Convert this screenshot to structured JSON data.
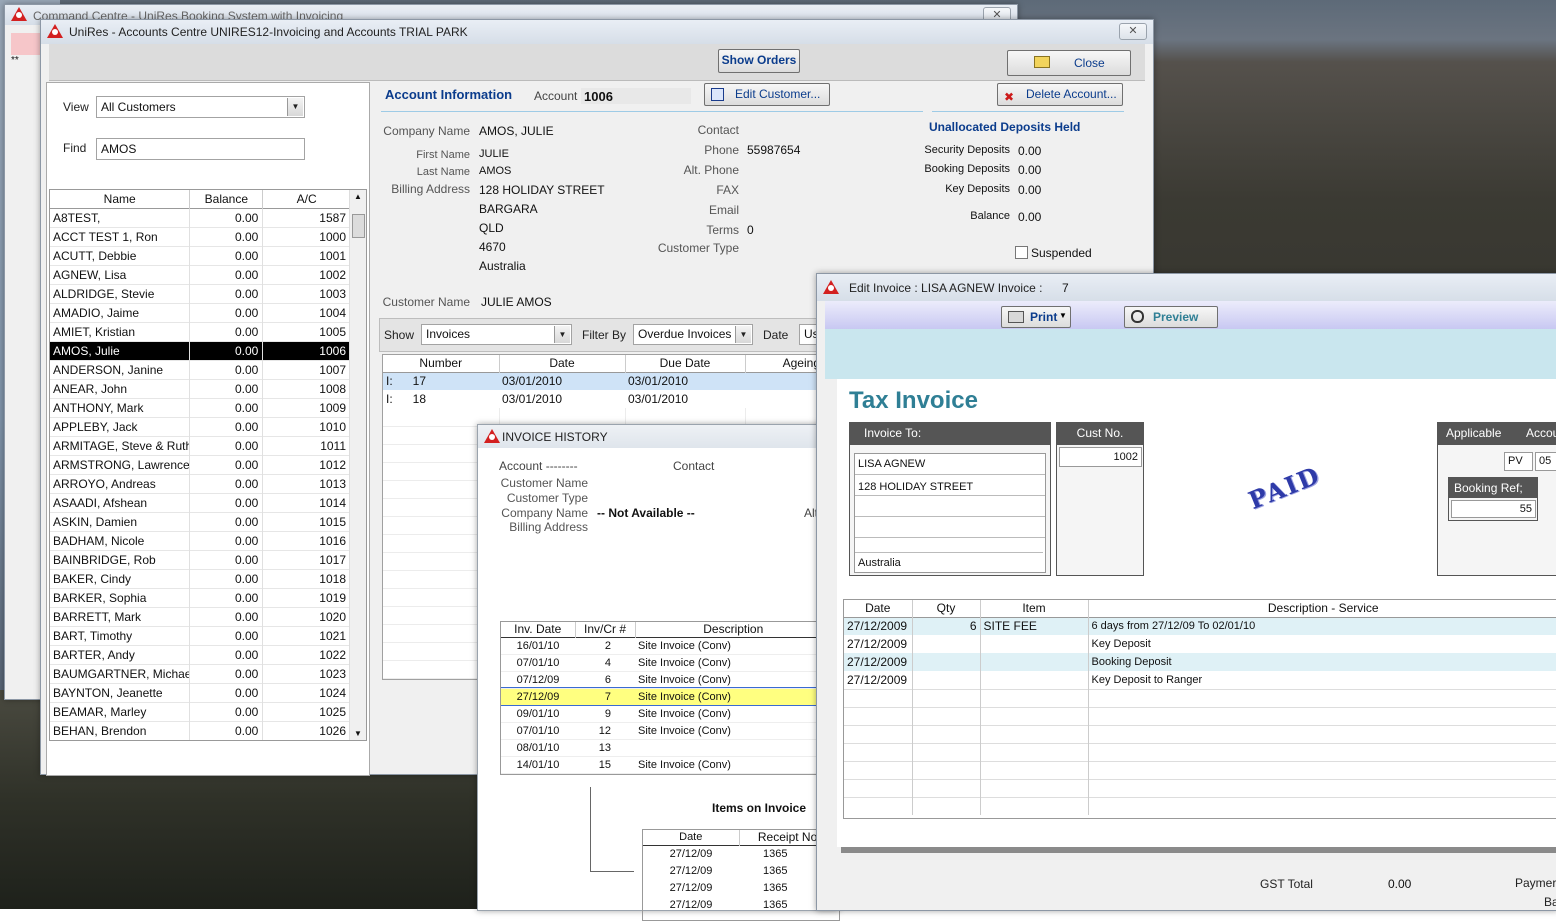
{
  "bg_window": {
    "title": "Command Centre - UniRes Booking System with Invoicing",
    "marker": "**"
  },
  "main_window": {
    "title": "UniRes - Accounts Centre UNIRES12-Invoicing and Accounts TRIAL PARK",
    "show_orders": "Show Orders",
    "close": "Close",
    "view_label": "View",
    "view_value": "All Customers",
    "find_label": "Find",
    "find_value": "AMOS",
    "list_headers": [
      "Name",
      "Balance",
      "A/C"
    ],
    "customers": [
      {
        "name": "A8TEST,",
        "bal": "0.00",
        "ac": "1587"
      },
      {
        "name": "ACCT TEST 1, Ron",
        "bal": "0.00",
        "ac": "1000"
      },
      {
        "name": "ACUTT, Debbie",
        "bal": "0.00",
        "ac": "1001"
      },
      {
        "name": "AGNEW, Lisa",
        "bal": "0.00",
        "ac": "1002"
      },
      {
        "name": "ALDRIDGE, Stevie",
        "bal": "0.00",
        "ac": "1003"
      },
      {
        "name": "AMADIO, Jaime",
        "bal": "0.00",
        "ac": "1004"
      },
      {
        "name": "AMIET, Kristian",
        "bal": "0.00",
        "ac": "1005"
      },
      {
        "name": "AMOS, Julie",
        "bal": "0.00",
        "ac": "1006",
        "selected": true
      },
      {
        "name": "ANDERSON, Janine",
        "bal": "0.00",
        "ac": "1007"
      },
      {
        "name": "ANEAR, John",
        "bal": "0.00",
        "ac": "1008"
      },
      {
        "name": "ANTHONY, Mark",
        "bal": "0.00",
        "ac": "1009"
      },
      {
        "name": "APPLEBY, Jack",
        "bal": "0.00",
        "ac": "1010"
      },
      {
        "name": "ARMITAGE, Steve & Ruth",
        "bal": "0.00",
        "ac": "1011"
      },
      {
        "name": "ARMSTRONG, Lawrence",
        "bal": "0.00",
        "ac": "1012"
      },
      {
        "name": "ARROYO, Andreas",
        "bal": "0.00",
        "ac": "1013"
      },
      {
        "name": "ASAADI, Afshean",
        "bal": "0.00",
        "ac": "1014"
      },
      {
        "name": "ASKIN, Damien",
        "bal": "0.00",
        "ac": "1015"
      },
      {
        "name": "BADHAM, Nicole",
        "bal": "0.00",
        "ac": "1016"
      },
      {
        "name": "BAINBRIDGE, Rob",
        "bal": "0.00",
        "ac": "1017"
      },
      {
        "name": "BAKER, Cindy",
        "bal": "0.00",
        "ac": "1018"
      },
      {
        "name": "BARKER, Sophia",
        "bal": "0.00",
        "ac": "1019"
      },
      {
        "name": "BARRETT, Mark",
        "bal": "0.00",
        "ac": "1020"
      },
      {
        "name": "BART, Timothy",
        "bal": "0.00",
        "ac": "1021"
      },
      {
        "name": "BARTER, Andy",
        "bal": "0.00",
        "ac": "1022"
      },
      {
        "name": "BAUMGARTNER, Michae",
        "bal": "0.00",
        "ac": "1023"
      },
      {
        "name": "BAYNTON, Jeanette",
        "bal": "0.00",
        "ac": "1024"
      },
      {
        "name": "BEAMAR, Marley",
        "bal": "0.00",
        "ac": "1025"
      },
      {
        "name": "BEHAN, Brendon",
        "bal": "0.00",
        "ac": "1026"
      }
    ],
    "account": {
      "heading": "Account Information",
      "account_label": "Account",
      "account_no": "1006",
      "edit_customer": "Edit Customer...",
      "delete_account": "Delete Account...",
      "company_name_label": "Company Name",
      "company_name": "AMOS, JULIE",
      "first_name_label": "First Name",
      "first_name": "JULIE",
      "last_name_label": "Last Name",
      "last_name": "AMOS",
      "billing_label": "Billing Address",
      "address_lines": [
        "128 HOLIDAY STREET",
        "BARGARA",
        "QLD",
        "4670",
        "Australia"
      ],
      "contact_label": "Contact",
      "phone_label": "Phone",
      "phone": "55987654",
      "alt_phone_label": "Alt. Phone",
      "fax_label": "FAX",
      "email_label": "Email",
      "terms_label": "Terms",
      "terms": "0",
      "customer_type_label": "Customer Type",
      "customer_name_label": "Customer Name",
      "customer_name": "JULIE AMOS"
    },
    "deposits": {
      "heading": "Unallocated Deposits Held",
      "rows": [
        {
          "label": "Security Deposits",
          "value": "0.00"
        },
        {
          "label": "Booking Deposits",
          "value": "0.00"
        },
        {
          "label": "Key Deposits",
          "value": "0.00"
        }
      ],
      "balance_label": "Balance",
      "balance": "0.00",
      "suspended_label": "Suspended"
    },
    "filters": {
      "show_label": "Show",
      "show_value": "Invoices",
      "filter_label": "Filter By",
      "filter_value": "Overdue Invoices",
      "date_label": "Date",
      "date_value": "Us"
    },
    "inv_headers": [
      "Number",
      "Date",
      "Due Date",
      "Ageing"
    ],
    "invoices": [
      {
        "type": "I:",
        "num": "17",
        "date": "03/01/2010",
        "due": "03/01/2010",
        "selected": true
      },
      {
        "type": "I:",
        "num": "18",
        "date": "03/01/2010",
        "due": "03/01/2010"
      }
    ]
  },
  "history_window": {
    "title": "INVOICE HISTORY",
    "account_label": "Account --------",
    "contact_label": "Contact",
    "customer_name_label": "Customer Name",
    "customer_type_label": "Customer Type",
    "company_name_label": "Company Name",
    "billing_label": "Billing Address",
    "not_available": "-- Not Available --",
    "alt_fragment": "Alt",
    "headers": [
      "Inv. Date",
      "Inv/Cr #",
      "Description"
    ],
    "rows": [
      {
        "date": "16/01/10",
        "no": "2",
        "desc": "Site Invoice (Conv)"
      },
      {
        "date": "07/01/10",
        "no": "4",
        "desc": "Site Invoice (Conv)"
      },
      {
        "date": "07/12/09",
        "no": "6",
        "desc": "Site Invoice (Conv)"
      },
      {
        "date": "27/12/09",
        "no": "7",
        "desc": "Site Invoice (Conv)",
        "selected": true
      },
      {
        "date": "09/01/10",
        "no": "9",
        "desc": "Site Invoice (Conv)"
      },
      {
        "date": "07/01/10",
        "no": "12",
        "desc": "Site Invoice (Conv)"
      },
      {
        "date": "08/01/10",
        "no": "13",
        "desc": ""
      },
      {
        "date": "14/01/10",
        "no": "15",
        "desc": "Site Invoice (Conv)"
      }
    ],
    "items_heading": "Items on Invoice",
    "items_headers": [
      "Date",
      "Receipt No."
    ],
    "items_rows": [
      {
        "date": "27/12/09",
        "receipt": "1365"
      },
      {
        "date": "27/12/09",
        "receipt": "1365"
      },
      {
        "date": "27/12/09",
        "receipt": "1365"
      },
      {
        "date": "27/12/09",
        "receipt": "1365"
      }
    ]
  },
  "invoice_window": {
    "title_prefix": "Edit Invoice : LISA AGNEW Invoice :",
    "invoice_no": "7",
    "print": "Print",
    "preview": "Preview",
    "heading": "Tax Invoice",
    "invoice_to_label": "Invoice To:",
    "invoice_to_lines": [
      "LISA AGNEW",
      "128 HOLIDAY STREET",
      "",
      "",
      "Australia"
    ],
    "cust_no_label": "Cust No.",
    "cust_no": "1002",
    "stamp": "PAID",
    "applicable_label": "Applicable",
    "account_label": "Accour",
    "pv": "PV",
    "pv_num": "05",
    "booking_ref_label": "Booking Ref;",
    "booking_ref": "55",
    "line_headers": [
      "Date",
      "Qty",
      "Item",
      "Description - Service"
    ],
    "lines": [
      {
        "date": "27/12/2009",
        "qty": "6",
        "item": "SITE FEE",
        "desc": "6 days from 27/12/09 To 02/01/10"
      },
      {
        "date": "27/12/2009",
        "qty": "",
        "item": "",
        "desc": "Key Deposit"
      },
      {
        "date": "27/12/2009",
        "qty": "",
        "item": "",
        "desc": "Booking Deposit"
      },
      {
        "date": "27/12/2009",
        "qty": "",
        "item": "",
        "desc": "Key Deposit to Ranger"
      }
    ],
    "gst_label": "GST Total",
    "gst_value": "0.00",
    "payment_label": "Paymer",
    "balance_fragment": "Ba"
  },
  "colors": {
    "accent": "#0b3c8c",
    "selection": "#000000",
    "history_selection": "#ffff80",
    "invoice_band": "#c9e6ee",
    "invoice_panel": "#dff1f6",
    "heading_teal": "#2f7f95"
  }
}
